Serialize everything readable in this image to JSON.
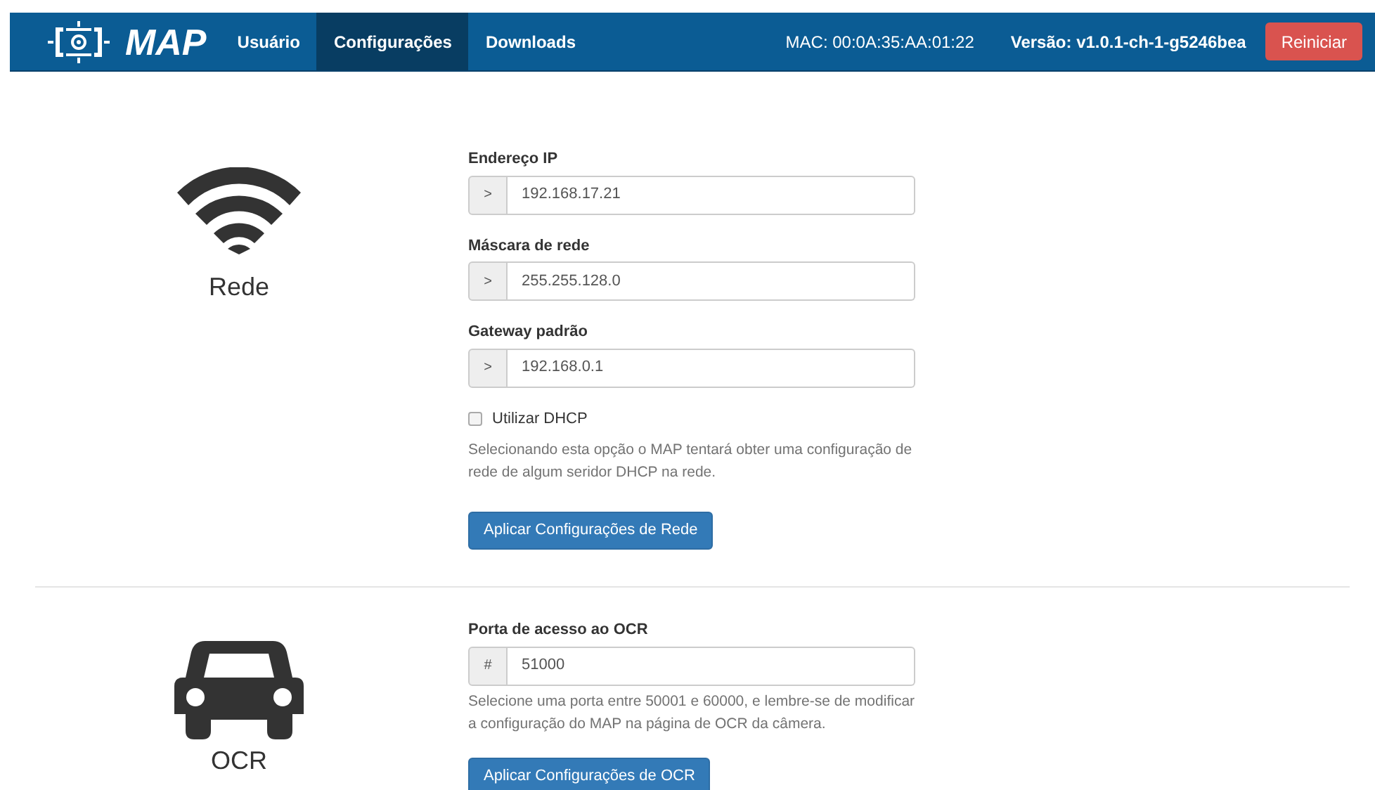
{
  "navbar": {
    "brand": "MAP",
    "tabs": [
      {
        "label": "Usuário",
        "selected": false
      },
      {
        "label": "Configurações",
        "selected": true
      },
      {
        "label": "Downloads",
        "selected": false
      }
    ],
    "mac": "MAC: 00:0A:35:AA:01:22",
    "version": "Versão: v1.0.1-ch-1-g5246bea",
    "restart_button": "Reiniciar"
  },
  "sections": [
    {
      "kind": "network",
      "title": "Rede",
      "fields": [
        {
          "label": "Endereço IP",
          "addon": ">",
          "value": "192.168.17.21"
        },
        {
          "label": "Máscara de rede",
          "addon": ">",
          "value": "255.255.128.0"
        },
        {
          "label": "Gateway padrão",
          "addon": ">",
          "value": "192.168.0.1"
        }
      ],
      "checkbox": {
        "label": "Utilizar DHCP",
        "checked": false
      },
      "help": "Selecionando esta opção o MAP tentará obter uma configuração de rede de algum seridor DHCP na rede.",
      "button": "Aplicar Configurações de Rede"
    },
    {
      "kind": "ocr",
      "title": "OCR",
      "fields": [
        {
          "label": "Porta de acesso ao OCR",
          "addon": "#",
          "value": "51000"
        }
      ],
      "help": "Selecione uma porta entre 50001 e 60000, e lembre-se de modificar a configuração do MAP na página de OCR da câmera.",
      "button": "Aplicar Configurações de OCR"
    }
  ]
}
